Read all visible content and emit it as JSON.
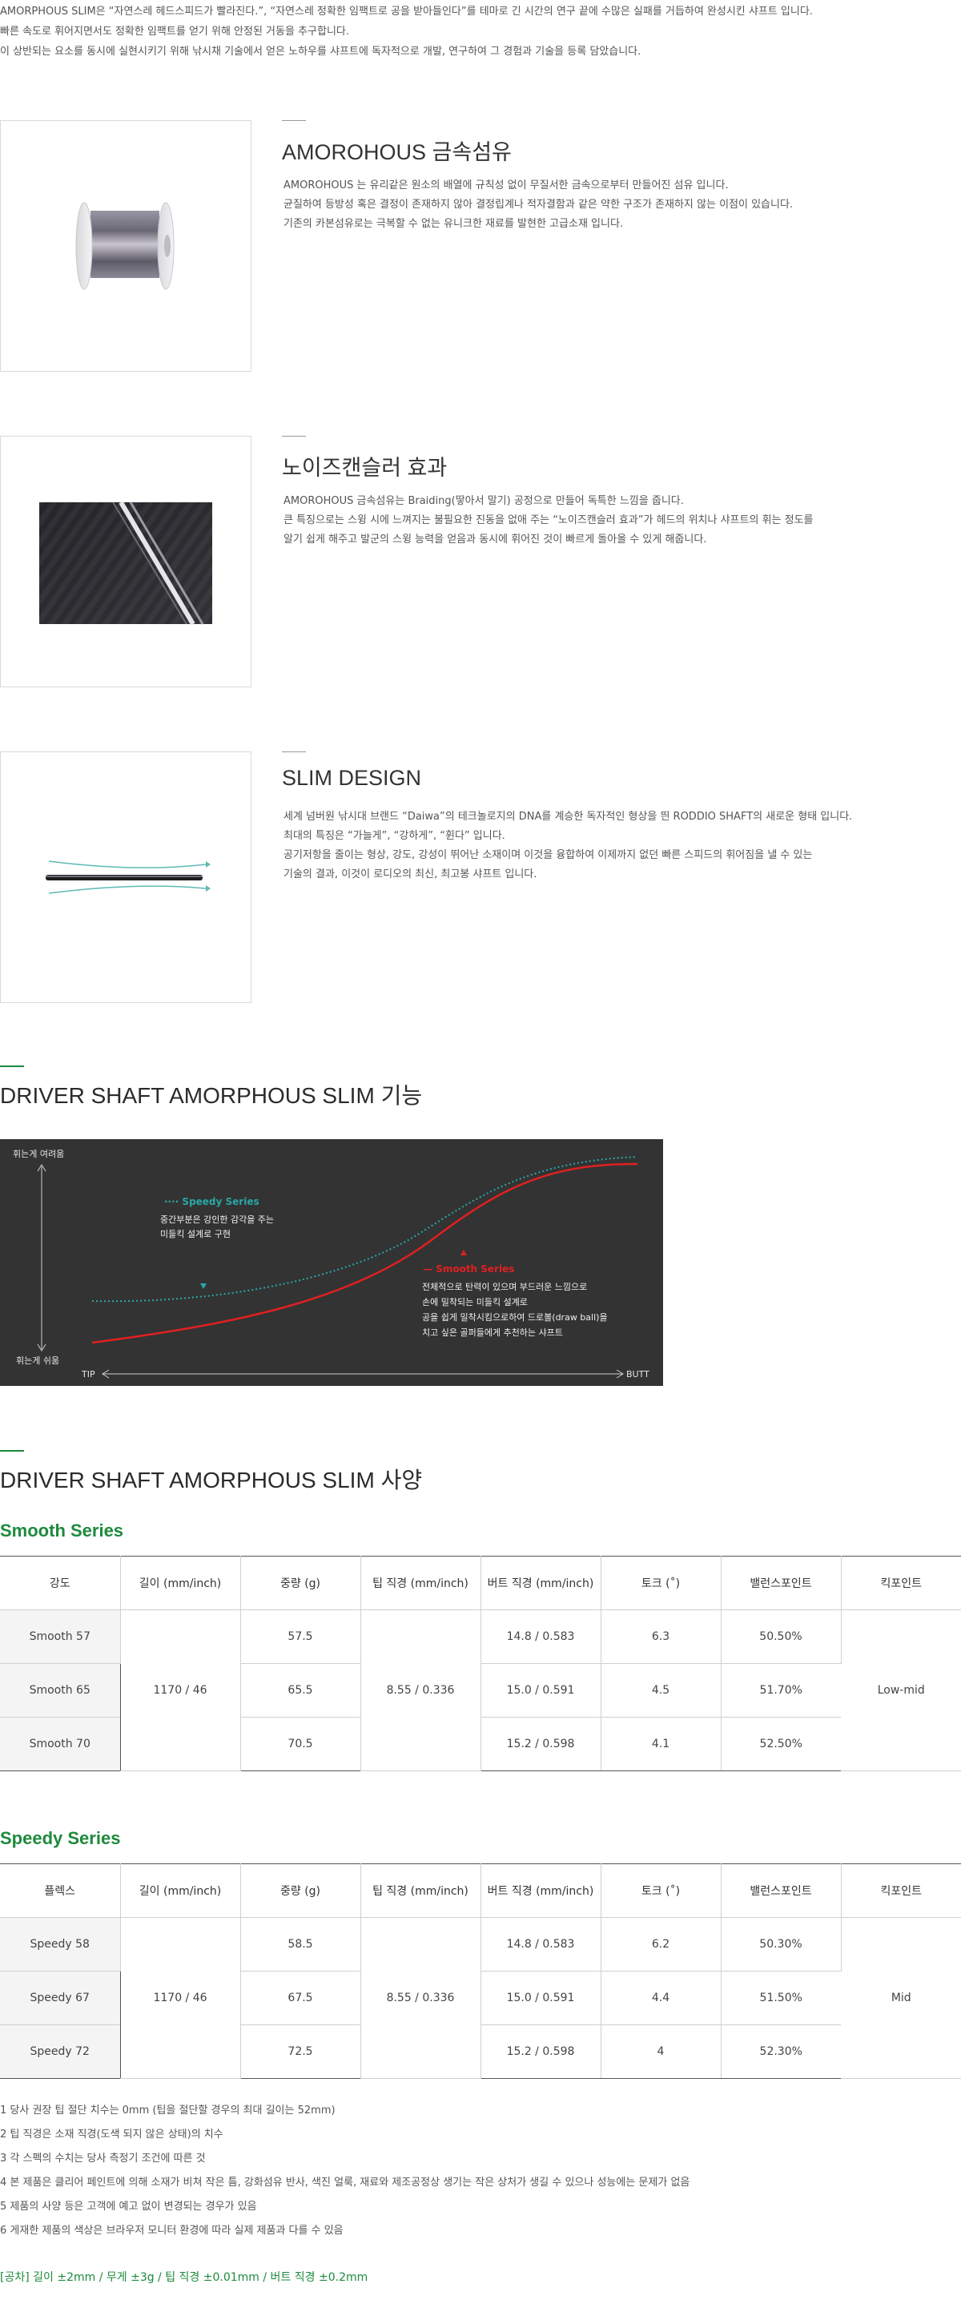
{
  "intro": [
    "AMORPHOUS SLIM은 “자연스레 헤드스피드가 빨라진다.”, “자연스레 정확한 임팩트로 공을 받아들인다”를 테마로 긴 시간의 연구 끝에 수많은 실패를 거듭하여 완성시킨 샤프트 입니다.",
    "빠른 속도로 휘어지면서도 정확한 임팩트를 얻기 위해 안정된 거동을 추구합니다.",
    "이 상반되는 요소를 동시에 실현시키기 위해 낚시채 기술에서 얻은 노하우를 샤프트에 독자적으로 개발, 연구하여 그 경험과 기술을 등록 담았습니다."
  ],
  "features": [
    {
      "title": "AMOROHOUS 금속섬유",
      "lines": [
        "AMOROHOUS 는 유리같은 원소의 배열에 규칙성 없이 무질서한 금속으로부터 만들어진 섬유 입니다.",
        "균질하여 등방성 혹은 결정이 존재하지 않아 결정립계나 적자결함과 같은 약한 구조가 존재하지 않는 이점이 있습니다.",
        "기존의 카본섬유로는 극복할 수 없는 유니크한 재료를 발현한 고급소재 입니다."
      ]
    },
    {
      "title": "노이즈캔슬러 효과",
      "lines": [
        "AMOROHOUS 금속섬유는 Braiding(땋아서 말기) 공정으로 만들어 독특한 느낌을 줍니다.",
        "큰 특징으로는 스윙 시에 느껴지는 불필요한 진동을 없애 주는 “노이즈캔슬러 효과”가 헤드의 위치나 샤프트의 휘는 정도를",
        "알기 쉽게 해주고 발군의 스윙 능력을 얻음과 동시에 휘어진 것이 빠르게 돌아올 수 있게 해줍니다."
      ]
    },
    {
      "title": "SLIM DESIGN",
      "lines": [
        "세계 넘버원 낚시대 브랜드 “Daiwa”의 테크놀로지의 DNA를 계승한 독자적인 형상을 띈 RODDIO SHAFT의 새로운 형태 입니다.",
        "최대의 특징은 “가늘게”, “강하게”, “휜다” 입니다.",
        "공기저항을 줄이는 형상, 강도, 강성이 뛰어난 소재이며 이것을 융합하여 이제까지 없던 빠른 스피드의 휘어짐을 낼 수 있는",
        "기술의 결과, 이것이 로디오의 최신, 최고봉 샤프트 입니다."
      ]
    }
  ],
  "function_heading": "DRIVER SHAFT AMORPHOUS SLIM 기능",
  "chart_data": {
    "type": "line",
    "ylabel_top": "휘는게 여려움",
    "ylabel_bottom": "휘는게 쉬움",
    "xlabel_left": "TIP",
    "xlabel_right": "BUTT",
    "series": [
      {
        "name": "Speedy Series",
        "color": "#2aa7a6",
        "style": "dotted",
        "desc": [
          "중간부분은 강인한 감각을 주는",
          "미들킥 설계로 구현"
        ]
      },
      {
        "name": "Smooth Series",
        "color": "#e02020",
        "style": "solid",
        "desc": [
          "전체적으로 탄력이 있으며 부드러운 느낌으로",
          "손에 밀착되는 미들킥 설계로",
          "공을 쉽게 밀착시킴으로하여 드로볼(draw ball)을",
          "치고 싶은 골퍼들에게 추천하는 샤프트"
        ]
      }
    ]
  },
  "spec_heading": "DRIVER SHAFT AMORPHOUS SLIM 사양",
  "smooth": {
    "title": "Smooth Series",
    "headers": [
      "강도",
      "길이 (mm/inch)",
      "중량 (g)",
      "팁 직경 (mm/inch)",
      "버트 직경 (mm/inch)",
      "토크 (˚)",
      "밸런스포인트",
      "킥포인트"
    ],
    "names": [
      "Smooth 57",
      "Smooth 65",
      "Smooth 70"
    ],
    "weights": [
      "57.5",
      "65.5",
      "70.5"
    ],
    "butts": [
      "14.8 / 0.583",
      "15.0 / 0.591",
      "15.2 / 0.598"
    ],
    "torques": [
      "6.3",
      "4.5",
      "4.1"
    ],
    "balances": [
      "50.50%",
      "51.70%",
      "52.50%"
    ],
    "length": "1170 / 46",
    "tip": "8.55 / 0.336",
    "kick": "Low-mid"
  },
  "speedy": {
    "title": "Speedy Series",
    "headers": [
      "플렉스",
      "길이 (mm/inch)",
      "중량 (g)",
      "팁 직경 (mm/inch)",
      "버트 직경 (mm/inch)",
      "토크 (˚)",
      "밸런스포인트",
      "킥포인트"
    ],
    "names": [
      "Speedy 58",
      "Speedy 67",
      "Speedy 72"
    ],
    "weights": [
      "58.5",
      "67.5",
      "72.5"
    ],
    "butts": [
      "14.8 / 0.583",
      "15.0 / 0.591",
      "15.2 / 0.598"
    ],
    "torques": [
      "6.2",
      "4.4",
      "4"
    ],
    "balances": [
      "50.30%",
      "51.50%",
      "52.30%"
    ],
    "length": "1170 / 46",
    "tip": "8.55 / 0.336",
    "kick": "Mid"
  },
  "notes": [
    "1  당사 권장 팁 절단 치수는 0mm (팁을 절단할 경우의 최대 길이는 52mm)",
    "2  팁 직경은 소재 직경(도색 되지 않은 상태)의 치수",
    "3  각 스펙의 수치는 당사 측정기 조건에 따른 것",
    "4  본 제품은 클리어 페인트에 의해 소재가 비쳐 작은 틈, 강화섬유 반사, 색진 얼룩, 재료와 제조공정상 생기는 작은 상처가 생길 수 있으나 성능에는 문제가 없음",
    "5  제품의 사양 등은 고객에 예고 없이 변경되는 경우가 있음",
    "6  게재한 제품의 색상은 브라우저 모니터 환경에 따라 실제 제품과 다를 수 있음"
  ],
  "tolerance": "[공차]  길이 ±2mm / 무게 ±3g / 팁 직경 ±0.01mm / 버트 직경 ±0.2mm"
}
